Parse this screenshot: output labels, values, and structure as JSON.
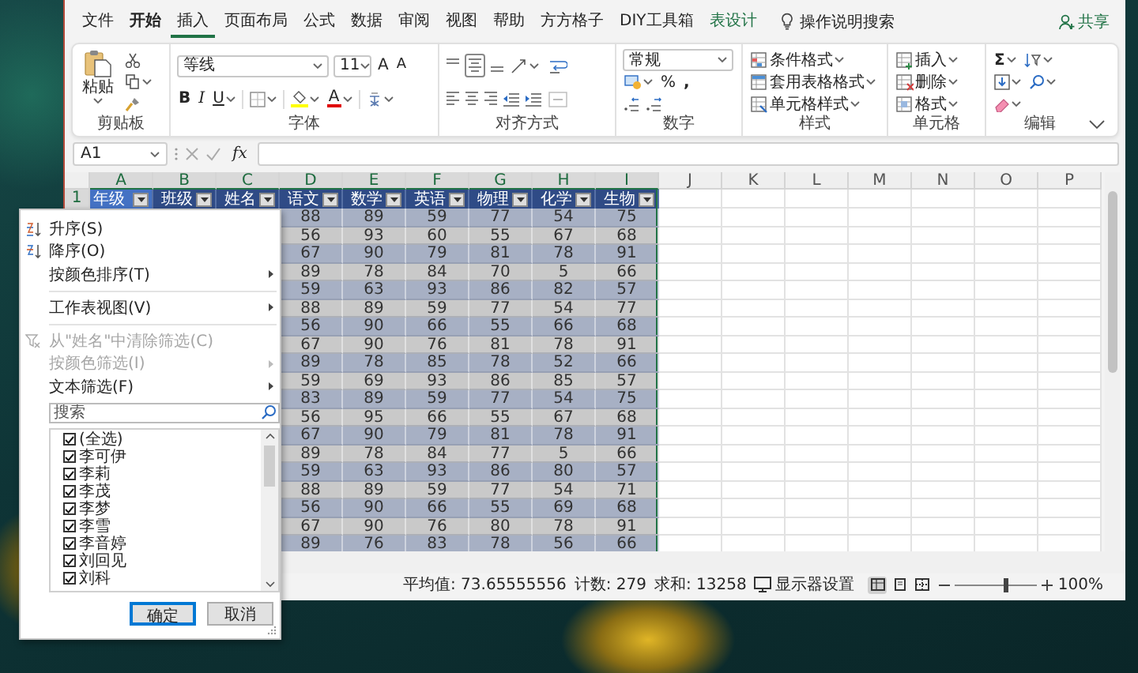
{
  "ribbon_tabs": [
    {
      "label": "文件",
      "kind": "plain",
      "selected": false
    },
    {
      "label": "开始",
      "kind": "bold",
      "selected": false
    },
    {
      "label": "插入",
      "kind": "plain",
      "selected": true
    },
    {
      "label": "页面布局",
      "kind": "plain",
      "selected": false
    },
    {
      "label": "公式",
      "kind": "plain",
      "selected": false
    },
    {
      "label": "数据",
      "kind": "plain",
      "selected": false
    },
    {
      "label": "审阅",
      "kind": "plain",
      "selected": false
    },
    {
      "label": "视图",
      "kind": "plain",
      "selected": false
    },
    {
      "label": "帮助",
      "kind": "plain",
      "selected": false
    },
    {
      "label": "方方格子",
      "kind": "plain",
      "selected": false
    },
    {
      "label": "DIY工具箱",
      "kind": "plain",
      "selected": false
    },
    {
      "label": "表设计",
      "kind": "contextual",
      "selected": false
    }
  ],
  "tell_me": "操作说明搜索",
  "share": "共享",
  "ribbon": {
    "groups": [
      {
        "kind": "clipboard",
        "label": "剪贴板",
        "paste": "粘贴"
      },
      {
        "kind": "font",
        "label": "字体",
        "font_name": "等线",
        "font_size": "11",
        "grow": "A",
        "shrink": "A",
        "bold": "B",
        "italic": "I",
        "underline": "U",
        "font_color": "A"
      },
      {
        "kind": "alignment",
        "label": "对齐方式"
      },
      {
        "kind": "number",
        "label": "数字",
        "format": "常规",
        "percent": "%",
        "comma": ","
      },
      {
        "kind": "styles",
        "label": "样式",
        "commands": [
          "条件格式",
          "套用表格格式",
          "单元格样式"
        ]
      },
      {
        "kind": "cells",
        "label": "单元格",
        "commands": [
          "插入",
          "删除",
          "格式"
        ]
      },
      {
        "kind": "editing",
        "label": "编辑",
        "sum": "Σ"
      }
    ]
  },
  "formula_bar": {
    "name_box": "A1",
    "fx": "fx"
  },
  "sheet": {
    "columns": [
      {
        "label": "A",
        "selected": true
      },
      {
        "label": "B",
        "selected": true
      },
      {
        "label": "C",
        "selected": true
      },
      {
        "label": "D",
        "selected": true
      },
      {
        "label": "E",
        "selected": true
      },
      {
        "label": "F",
        "selected": true
      },
      {
        "label": "G",
        "selected": true
      },
      {
        "label": "H",
        "selected": true
      },
      {
        "label": "I",
        "selected": true
      },
      {
        "label": "J",
        "selected": false
      },
      {
        "label": "K",
        "selected": false
      },
      {
        "label": "L",
        "selected": false
      },
      {
        "label": "M",
        "selected": false
      },
      {
        "label": "N",
        "selected": false
      },
      {
        "label": "O",
        "selected": false
      },
      {
        "label": "P",
        "selected": false
      }
    ],
    "row_numbers": [
      {
        "label": "1",
        "selected": true
      }
    ],
    "header_row": [
      {
        "text": "年级",
        "selected": true
      },
      {
        "text": "班级",
        "selected": false
      },
      {
        "text": "姓名",
        "selected": false
      },
      {
        "text": "语文",
        "selected": false
      },
      {
        "text": "数学",
        "selected": false
      },
      {
        "text": "英语",
        "selected": false
      },
      {
        "text": "物理",
        "selected": false
      },
      {
        "text": "化学",
        "selected": false
      },
      {
        "text": "生物",
        "selected": false
      }
    ],
    "rows": [
      [
        "",
        "",
        "",
        "88",
        "89",
        "59",
        "77",
        "54",
        "75"
      ],
      [
        "",
        "",
        "",
        "56",
        "93",
        "60",
        "55",
        "67",
        "68"
      ],
      [
        "",
        "",
        "",
        "67",
        "90",
        "79",
        "81",
        "78",
        "91"
      ],
      [
        "",
        "",
        "",
        "89",
        "78",
        "84",
        "70",
        "5",
        "66"
      ],
      [
        "",
        "",
        "",
        "59",
        "63",
        "93",
        "86",
        "82",
        "57"
      ],
      [
        "",
        "",
        "",
        "88",
        "89",
        "59",
        "77",
        "54",
        "77"
      ],
      [
        "",
        "",
        "",
        "56",
        "90",
        "66",
        "55",
        "66",
        "68"
      ],
      [
        "",
        "",
        "",
        "67",
        "90",
        "76",
        "81",
        "78",
        "91"
      ],
      [
        "",
        "",
        "",
        "89",
        "78",
        "85",
        "78",
        "52",
        "66"
      ],
      [
        "",
        "",
        "",
        "59",
        "69",
        "93",
        "86",
        "85",
        "57"
      ],
      [
        "",
        "",
        "",
        "83",
        "89",
        "59",
        "77",
        "54",
        "75"
      ],
      [
        "",
        "",
        "",
        "56",
        "95",
        "66",
        "55",
        "67",
        "68"
      ],
      [
        "",
        "",
        "",
        "67",
        "90",
        "79",
        "81",
        "78",
        "91"
      ],
      [
        "",
        "",
        "",
        "89",
        "78",
        "84",
        "77",
        "5",
        "66"
      ],
      [
        "",
        "",
        "",
        "59",
        "63",
        "93",
        "86",
        "80",
        "57"
      ],
      [
        "",
        "",
        "",
        "88",
        "89",
        "59",
        "77",
        "54",
        "71"
      ],
      [
        "",
        "",
        "",
        "56",
        "90",
        "66",
        "55",
        "69",
        "68"
      ],
      [
        "",
        "",
        "",
        "67",
        "90",
        "76",
        "80",
        "78",
        "91"
      ],
      [
        "",
        "",
        "",
        "89",
        "76",
        "83",
        "78",
        "56",
        "66"
      ]
    ]
  },
  "status_bar": {
    "average": "平均值: 73.65555556",
    "count": "计数: 279",
    "sum": "求和: 13258",
    "display_settings": "显示器设置",
    "views": [
      {
        "kind": "normal",
        "selected": true
      },
      {
        "kind": "page-layout",
        "selected": false
      },
      {
        "kind": "page-break",
        "selected": false
      }
    ],
    "zoom": {
      "level": 0.6,
      "reading": "100%"
    }
  },
  "filter_menu": {
    "items": [
      {
        "kind": "sort-asc",
        "label": "升序(S)",
        "disabled": false,
        "submenu": false
      },
      {
        "kind": "sort-desc",
        "label": "降序(O)",
        "disabled": false,
        "submenu": false
      },
      {
        "kind": "plain",
        "label": "按颜色排序(T)",
        "disabled": false,
        "submenu": true
      },
      {
        "kind": "divider"
      },
      {
        "kind": "plain",
        "label": "工作表视图(V)",
        "disabled": false,
        "submenu": true
      },
      {
        "kind": "divider"
      },
      {
        "kind": "clear-filter",
        "label": "从\"姓名\"中清除筛选(C)",
        "disabled": true,
        "submenu": false
      },
      {
        "kind": "plain",
        "label": "按颜色筛选(I)",
        "disabled": true,
        "submenu": true
      },
      {
        "kind": "plain",
        "label": "文本筛选(F)",
        "disabled": false,
        "submenu": true
      }
    ],
    "search": {
      "placeholder": "搜索"
    },
    "values": [
      {
        "label": "(全选)",
        "checked": true
      },
      {
        "label": "李可伊",
        "checked": true
      },
      {
        "label": "李莉",
        "checked": true
      },
      {
        "label": "李茂",
        "checked": true
      },
      {
        "label": "李梦",
        "checked": true
      },
      {
        "label": "李雪",
        "checked": true
      },
      {
        "label": "李音婷",
        "checked": true
      },
      {
        "label": "刘回见",
        "checked": true
      },
      {
        "label": "刘科",
        "checked": true
      }
    ],
    "ok": "确定",
    "cancel": "取消"
  }
}
